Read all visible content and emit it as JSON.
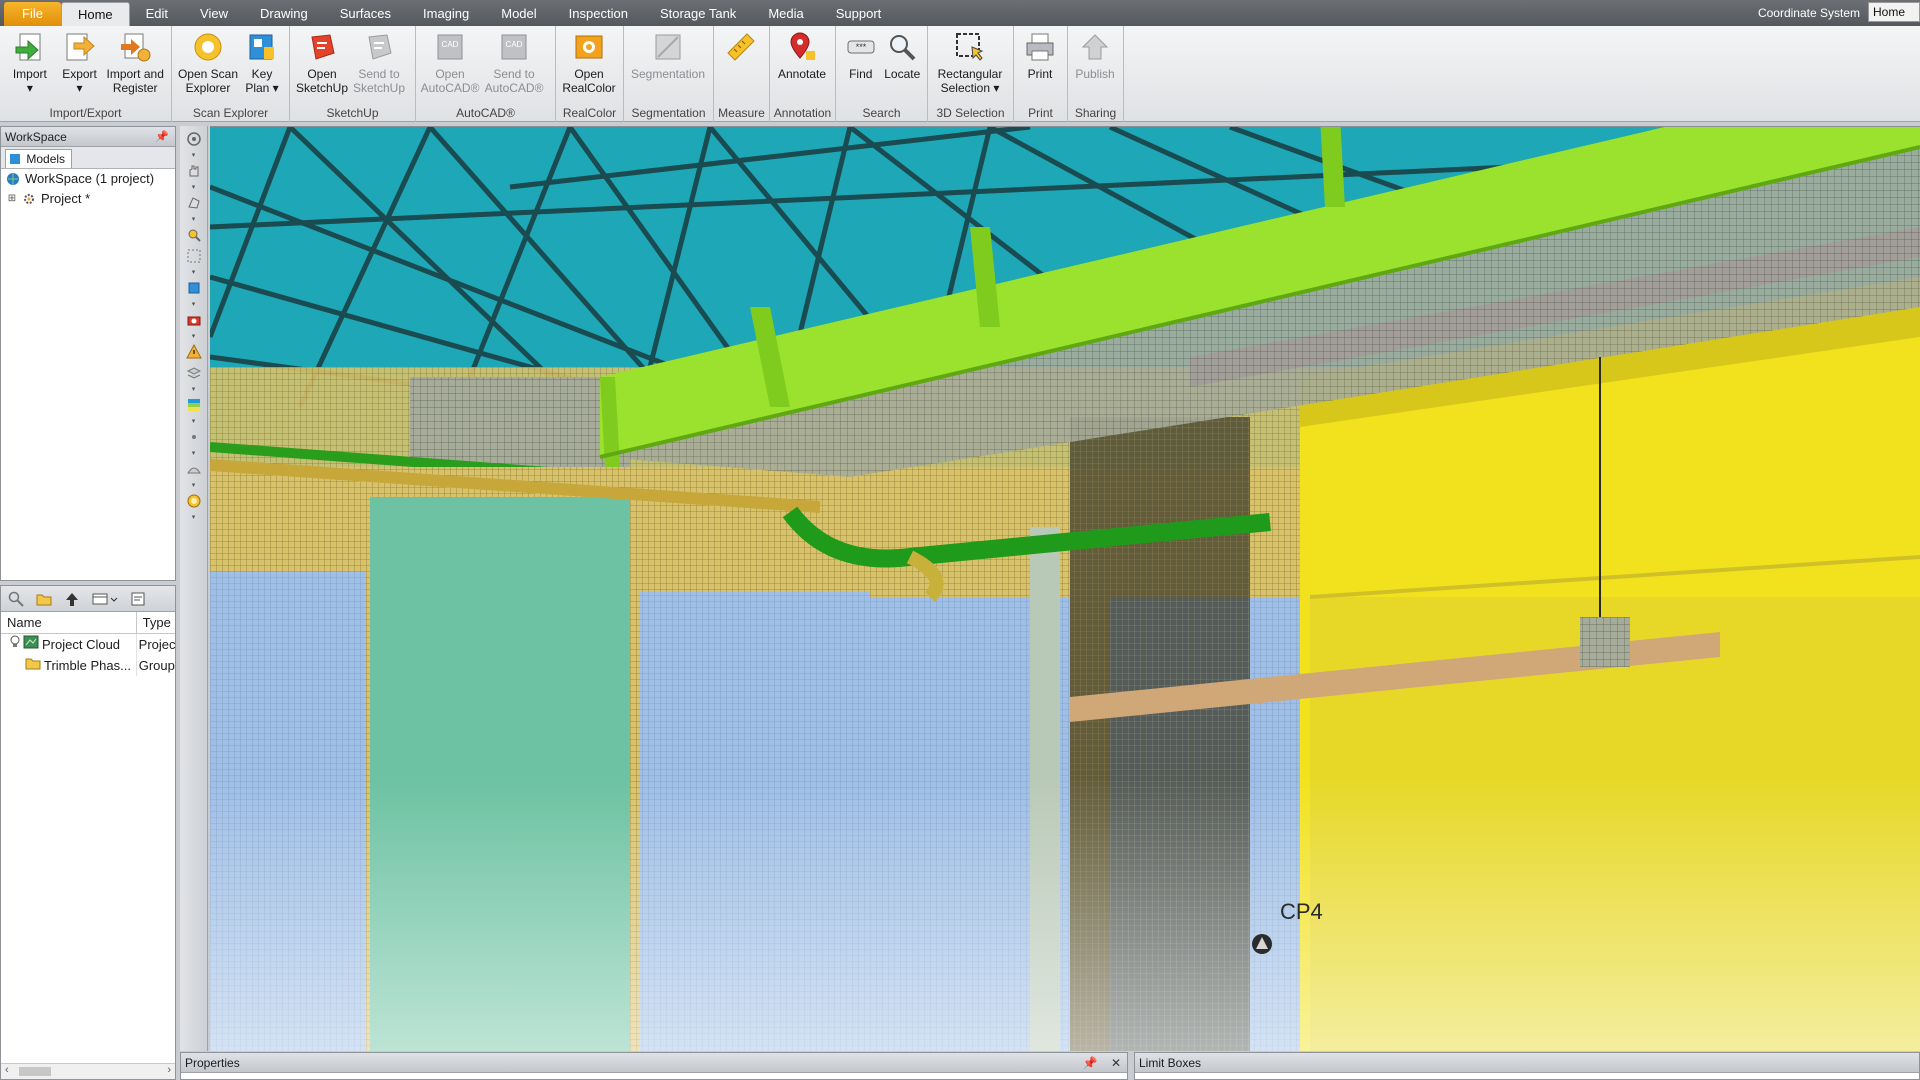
{
  "menu": {
    "tabs": [
      "File",
      "Home",
      "Edit",
      "View",
      "Drawing",
      "Surfaces",
      "Imaging",
      "Model",
      "Inspection",
      "Storage Tank",
      "Media",
      "Support"
    ],
    "active": "Home",
    "coordinate_system": "Coordinate System",
    "coordinate_value": "Home"
  },
  "ribbon": {
    "groups": [
      {
        "label": "Import/Export",
        "buttons": [
          {
            "l1": "Import",
            "l2": "▾",
            "icon": "import-icon",
            "enabled": true
          },
          {
            "l1": "Export",
            "l2": "▾",
            "icon": "export-icon",
            "enabled": true
          },
          {
            "l1": "Import and",
            "l2": "Register",
            "icon": "import-register-icon",
            "enabled": true
          }
        ]
      },
      {
        "label": "Scan Explorer",
        "buttons": [
          {
            "l1": "Open Scan",
            "l2": "Explorer",
            "icon": "scan-explorer-icon",
            "enabled": true
          },
          {
            "l1": "Key",
            "l2": "Plan ▾",
            "icon": "key-plan-icon",
            "enabled": true
          }
        ]
      },
      {
        "label": "SketchUp",
        "buttons": [
          {
            "l1": "Open",
            "l2": "SketchUp",
            "icon": "sketchup-icon",
            "enabled": true
          },
          {
            "l1": "Send to",
            "l2": "SketchUp",
            "icon": "send-sketchup-icon",
            "enabled": false
          }
        ]
      },
      {
        "label": "AutoCAD®",
        "buttons": [
          {
            "l1": "Open",
            "l2": "AutoCAD®",
            "icon": "autocad-icon",
            "enabled": false
          },
          {
            "l1": "Send to",
            "l2": "AutoCAD®",
            "icon": "send-autocad-icon",
            "enabled": false
          }
        ]
      },
      {
        "label": "RealColor",
        "buttons": [
          {
            "l1": "Open",
            "l2": "RealColor",
            "icon": "realcolor-icon",
            "enabled": true
          }
        ]
      },
      {
        "label": "Segmentation",
        "buttons": [
          {
            "l1": "Segmentation",
            "l2": "",
            "icon": "segmentation-icon",
            "enabled": false
          }
        ]
      },
      {
        "label": "Measure",
        "buttons": [
          {
            "l1": "",
            "l2": "",
            "icon": "ruler-icon",
            "enabled": true
          }
        ]
      },
      {
        "label": "Annotation",
        "buttons": [
          {
            "l1": "Annotate",
            "l2": "",
            "icon": "annotate-icon",
            "enabled": true
          }
        ]
      },
      {
        "label": "Search",
        "buttons": [
          {
            "l1": "Find",
            "l2": "",
            "icon": "find-icon",
            "enabled": true
          },
          {
            "l1": "Locate",
            "l2": "",
            "icon": "locate-icon",
            "enabled": true
          }
        ]
      },
      {
        "label": "3D Selection",
        "buttons": [
          {
            "l1": "Rectangular",
            "l2": "Selection ▾",
            "icon": "rect-selection-icon",
            "enabled": true
          }
        ]
      },
      {
        "label": "Print",
        "buttons": [
          {
            "l1": "Print",
            "l2": "",
            "icon": "printer-icon",
            "enabled": true
          }
        ]
      },
      {
        "label": "Sharing",
        "buttons": [
          {
            "l1": "Publish",
            "l2": "",
            "icon": "publish-icon",
            "enabled": false
          }
        ]
      }
    ]
  },
  "workspace": {
    "title": "WorkSpace",
    "tab": "Models",
    "root": "WorkSpace  (1 project)",
    "project": "Project  *"
  },
  "project_panel": {
    "columns": [
      "Name",
      "Type"
    ],
    "rows": [
      {
        "name": "Project Cloud",
        "type": "Project"
      },
      {
        "name": "Trimble Phas...",
        "type": "Group"
      }
    ]
  },
  "viewport": {
    "marker_label": "CP4"
  },
  "bottom": {
    "properties_title": "Properties",
    "limit_boxes_title": "Limit Boxes"
  },
  "colors": {
    "accent_orange": "#f0a21c",
    "sky": "#1ea7b6",
    "duct_green": "#9be22f",
    "wall_yellow": "#f2e21e"
  }
}
